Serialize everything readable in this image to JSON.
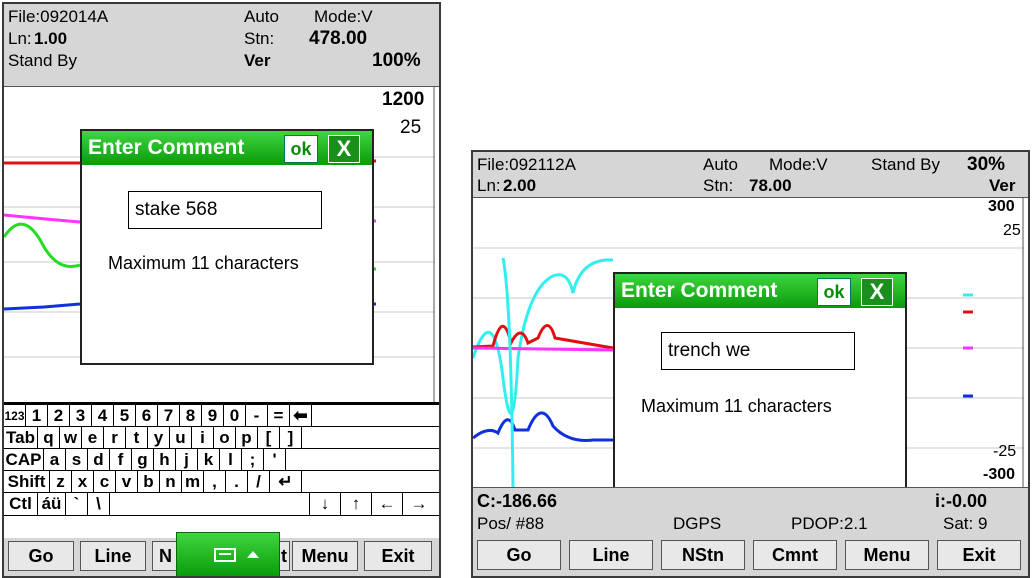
{
  "left_screen": {
    "status": {
      "file": "File:092014A",
      "auto": "Auto",
      "mode": "Mode:V",
      "ln_label": "Ln:",
      "ln_value": "1.00",
      "stn_label": "Stn:",
      "stn_value": "478.00",
      "standby": "Stand By",
      "ver": "Ver",
      "percent": "100%"
    },
    "scale_top": "1200",
    "scale_second": "25",
    "dialog": {
      "title": "Enter Comment",
      "ok": "ok",
      "close": "X",
      "input_value": "stake 568",
      "hint": "Maximum 11 characters"
    },
    "keyboard": {
      "rows": [
        [
          "123",
          "1",
          "2",
          "3",
          "4",
          "5",
          "6",
          "7",
          "8",
          "9",
          "0",
          "-",
          "=",
          "⬅"
        ],
        [
          "Tab",
          "q",
          "w",
          "e",
          "r",
          "t",
          "y",
          "u",
          "i",
          "o",
          "p",
          "[",
          "]"
        ],
        [
          "CAP",
          "a",
          "s",
          "d",
          "f",
          "g",
          "h",
          "j",
          "k",
          "l",
          ";",
          "'"
        ],
        [
          "Shift",
          "z",
          "x",
          "c",
          "v",
          "b",
          "n",
          "m",
          ",",
          ".",
          "/",
          "↵"
        ],
        [
          "Ctl",
          "áü",
          "`",
          "\\",
          "",
          "↓",
          "↑",
          "←",
          "→"
        ]
      ]
    },
    "menu": [
      "Go",
      "Line",
      "N",
      "t",
      "Menu",
      "Exit"
    ],
    "sip_icon": "keyboard-icon"
  },
  "right_screen": {
    "status": {
      "file": "File:092112A",
      "auto": "Auto",
      "mode": "Mode:V",
      "standby": "Stand By",
      "percent": "30%",
      "ln_label": "Ln:",
      "ln_value": "2.00",
      "stn_label": "Stn:",
      "stn_value": "78.00",
      "ver": "Ver"
    },
    "scale": {
      "top": "300",
      "top2": "25",
      "bottom2": "-25",
      "bottom": "-300"
    },
    "dialog": {
      "title": "Enter Comment",
      "ok": "ok",
      "close": "X",
      "input_value": "trench we",
      "hint": "Maximum 11 characters"
    },
    "readout": {
      "c": "C:-186.66",
      "i": "i:-0.00",
      "pos": "Pos/ #88",
      "dgps": "DGPS",
      "pdop": "PDOP:2.1",
      "sat": "Sat: 9"
    },
    "menu": [
      "Go",
      "Line",
      "NStn",
      "Cmnt",
      "Menu",
      "Exit"
    ]
  },
  "colors": {
    "title_green": "#19b019",
    "red": "#e01010",
    "magenta": "#ff33ff",
    "green": "#22dd22",
    "blue": "#1030e0",
    "cyan": "#33eeee"
  }
}
